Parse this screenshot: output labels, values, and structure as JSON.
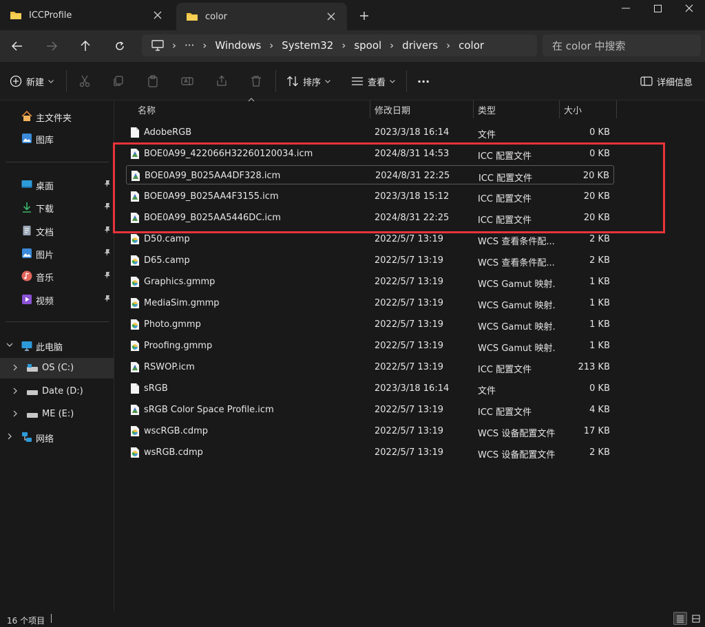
{
  "tabs": [
    {
      "label": "ICCProfile",
      "icon": "folder-icon"
    },
    {
      "label": "color",
      "icon": "folder-icon",
      "active": true
    }
  ],
  "address": {
    "crumbs": [
      "Windows",
      "System32",
      "spool",
      "drivers",
      "color"
    ],
    "overflow": "···",
    "search_placeholder": "在 color 中搜索"
  },
  "toolbar": {
    "new_label": "新建",
    "sort_label": "排序",
    "view_label": "查看",
    "more_label": "···",
    "details_label": "详细信息"
  },
  "sidebar": {
    "top": [
      {
        "label": "主文件夹",
        "icon": "home-icon"
      },
      {
        "label": "图库",
        "icon": "gallery-icon"
      }
    ],
    "pinned": [
      {
        "label": "桌面",
        "icon": "desktop-icon"
      },
      {
        "label": "下载",
        "icon": "download-icon"
      },
      {
        "label": "文档",
        "icon": "documents-icon"
      },
      {
        "label": "图片",
        "icon": "pictures-icon"
      },
      {
        "label": "音乐",
        "icon": "music-icon"
      },
      {
        "label": "视频",
        "icon": "videos-icon"
      }
    ],
    "this_pc": "此电脑",
    "drives": [
      {
        "label": "OS (C:)",
        "icon": "drive-icon"
      },
      {
        "label": "Date (D:)",
        "icon": "drive-icon"
      },
      {
        "label": "ME (E:)",
        "icon": "drive-icon"
      }
    ],
    "network": "网络"
  },
  "columns": {
    "name": "名称",
    "modified": "修改日期",
    "type": "类型",
    "size": "大小"
  },
  "files": [
    {
      "name": "AdobeRGB",
      "modified": "2023/3/18 16:14",
      "type": "文件",
      "size": "0 KB",
      "icon": "file-icon"
    },
    {
      "name": "BOE0A99_422066H32260120034.icm",
      "modified": "2024/8/31 14:53",
      "type": "ICC 配置文件",
      "size": "0 KB",
      "icon": "icc-icon"
    },
    {
      "name": "BOE0A99_B025AA4DF328.icm",
      "modified": "2024/8/31 22:25",
      "type": "ICC 配置文件",
      "size": "20 KB",
      "icon": "icc-icon"
    },
    {
      "name": "BOE0A99_B025AA4F3155.icm",
      "modified": "2023/3/18 15:12",
      "type": "ICC 配置文件",
      "size": "20 KB",
      "icon": "icc-icon"
    },
    {
      "name": "BOE0A99_B025AA5446DC.icm",
      "modified": "2024/8/31 22:25",
      "type": "ICC 配置文件",
      "size": "20 KB",
      "icon": "icc-icon"
    },
    {
      "name": "D50.camp",
      "modified": "2022/5/7 13:19",
      "type": "WCS 查看条件配...",
      "size": "2 KB",
      "icon": "wcs-icon"
    },
    {
      "name": "D65.camp",
      "modified": "2022/5/7 13:19",
      "type": "WCS 查看条件配...",
      "size": "2 KB",
      "icon": "wcs-icon"
    },
    {
      "name": "Graphics.gmmp",
      "modified": "2022/5/7 13:19",
      "type": "WCS Gamut 映射...",
      "size": "1 KB",
      "icon": "wcs-icon"
    },
    {
      "name": "MediaSim.gmmp",
      "modified": "2022/5/7 13:19",
      "type": "WCS Gamut 映射...",
      "size": "1 KB",
      "icon": "wcs-icon"
    },
    {
      "name": "Photo.gmmp",
      "modified": "2022/5/7 13:19",
      "type": "WCS Gamut 映射...",
      "size": "1 KB",
      "icon": "wcs-icon"
    },
    {
      "name": "Proofing.gmmp",
      "modified": "2022/5/7 13:19",
      "type": "WCS Gamut 映射...",
      "size": "1 KB",
      "icon": "wcs-icon"
    },
    {
      "name": "RSWOP.icm",
      "modified": "2022/5/7 13:19",
      "type": "ICC 配置文件",
      "size": "213 KB",
      "icon": "icc-icon"
    },
    {
      "name": "sRGB",
      "modified": "2023/3/18 16:14",
      "type": "文件",
      "size": "0 KB",
      "icon": "file-icon"
    },
    {
      "name": "sRGB Color Space Profile.icm",
      "modified": "2022/5/7 13:19",
      "type": "ICC 配置文件",
      "size": "4 KB",
      "icon": "icc-icon"
    },
    {
      "name": "wscRGB.cdmp",
      "modified": "2022/5/7 13:19",
      "type": "WCS 设备配置文件",
      "size": "17 KB",
      "icon": "wcs-icon"
    },
    {
      "name": "wsRGB.cdmp",
      "modified": "2022/5/7 13:19",
      "type": "WCS 设备配置文件",
      "size": "2 KB",
      "icon": "wcs-icon"
    }
  ],
  "status": {
    "item_count": "16 个项目"
  },
  "colors": {
    "highlight_box": "#e8333a",
    "folder": "#f0c040",
    "accent": "#4aa3df"
  }
}
